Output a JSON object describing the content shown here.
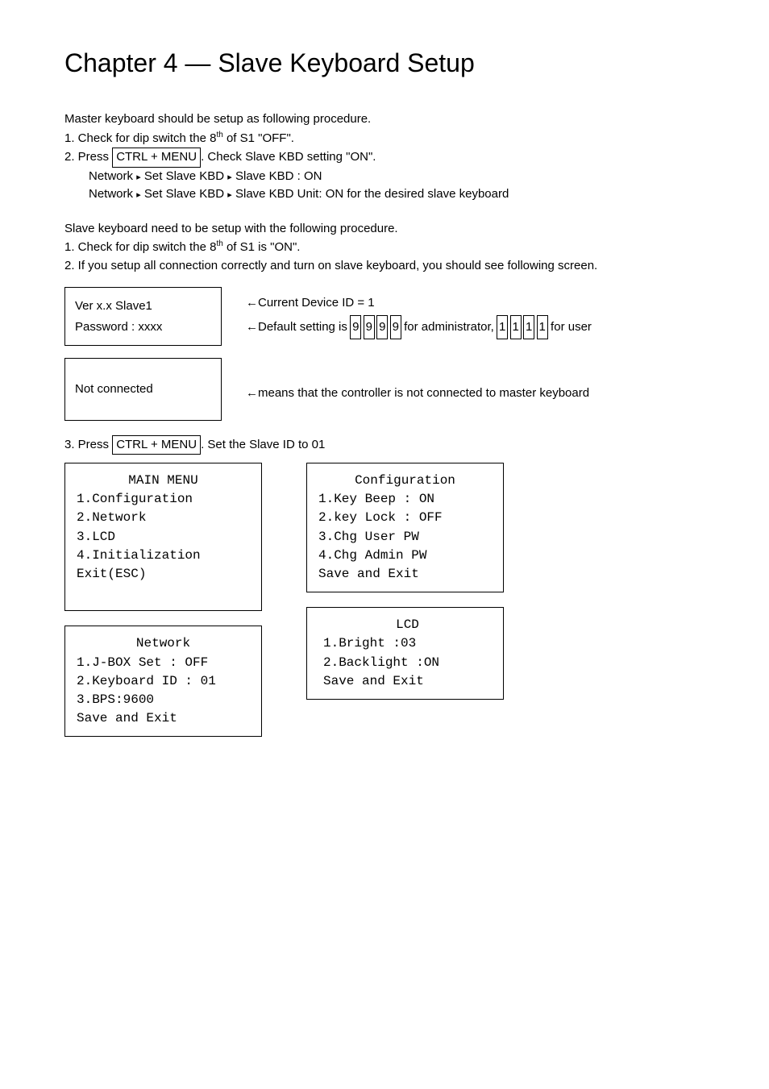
{
  "title": "Chapter 4 — Slave Keyboard Setup",
  "intro1": "Master keyboard should be setup as following procedure.",
  "step1_1_pre": "1. Check for dip switch the 8",
  "step1_1_th": "th",
  "step1_1_post": " of S1 \"OFF\".",
  "step1_2_pre": "2. Press ",
  "step1_2_key": "CTRL + MENU",
  "step1_2_post": ". Check Slave KBD setting \"ON\".",
  "step1_net1_pre": "Network ",
  "step1_net1_arrow": "▸",
  "step1_net1_mid1": " Set Slave KBD ",
  "step1_net1_mid2": " Slave KBD : ON",
  "step1_net2_pre": "Network ",
  "step1_net2_mid1": " Set Slave KBD ",
  "step1_net2_mid2": " Slave KBD Unit: ON for the desired slave keyboard",
  "intro2": "Slave keyboard need to be setup with the following procedure.",
  "step2_1_pre": "1. Check for dip switch the 8",
  "step2_1_th": "th",
  "step2_1_post": " of S1 is \"ON\".",
  "step2_2": "2. If you setup all connection correctly and turn on slave keyboard, you should see following screen.",
  "lcd1": {
    "line1": "Ver x.x Slave1",
    "line2": "Password : xxxx"
  },
  "lcd1_desc": {
    "arrow": "←",
    "line1": "Current Device ID = 1",
    "line2_pre": "Default setting is ",
    "d9": "9",
    "line2_mid": " for administrator, ",
    "d1": "1",
    "line2_post": " for user"
  },
  "lcd2": {
    "line1": "Not connected"
  },
  "lcd2_desc": {
    "arrow": "←",
    "text": "means that the controller is not connected to master keyboard"
  },
  "step3_pre": "3. Press ",
  "step3_key": "CTRL + MENU",
  "step3_post": ". Set the Slave ID to 01",
  "mainmenu": {
    "title": "MAIN MENU",
    "items": [
      "1.Configuration",
      "2.Network",
      "3.LCD",
      "4.Initialization",
      "Exit(ESC)"
    ]
  },
  "network": {
    "title": "Network",
    "items": [
      "1.J-BOX Set : OFF",
      "2.Keyboard ID : 01",
      "3.BPS:9600",
      "Save and Exit"
    ]
  },
  "config": {
    "title": "Configuration",
    "items": [
      "1.Key Beep : ON",
      "2.key Lock : OFF",
      "3.Chg User PW",
      "4.Chg Admin PW",
      "Save and Exit"
    ]
  },
  "lcdmenu": {
    "title": "LCD",
    "items": [
      "1.Bright     :03",
      "2.Backlight  :ON",
      "Save and Exit"
    ]
  }
}
